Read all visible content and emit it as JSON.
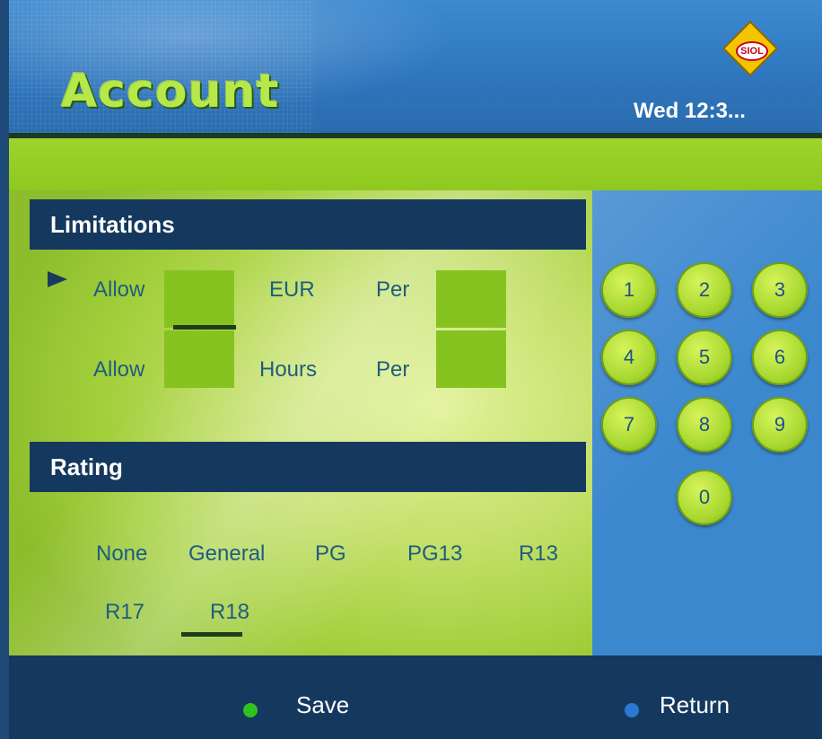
{
  "header": {
    "title": "Account",
    "logo_text": "SIOL",
    "clock": "Wed 12:3..."
  },
  "limitations": {
    "title": "Limitations",
    "rows": [
      {
        "allow_label": "Allow",
        "unit_label": "EUR",
        "per_label": "Per"
      },
      {
        "allow_label": "Allow",
        "unit_label": "Hours",
        "per_label": "Per"
      }
    ]
  },
  "rating": {
    "title": "Rating",
    "options": [
      "None",
      "General",
      "PG",
      "PG13",
      "R13",
      "R17",
      "R18"
    ],
    "selected": "R18"
  },
  "numpad": {
    "keys": [
      "1",
      "2",
      "3",
      "4",
      "5",
      "6",
      "7",
      "8",
      "9",
      "0"
    ]
  },
  "footer": {
    "save_label": "Save",
    "save_color": "#2ec21f",
    "return_label": "Return",
    "return_color": "#2b78d0"
  },
  "colors": {
    "accent_green": "#9ed42c",
    "navy": "#15385e",
    "label_blue": "#1e5d80"
  }
}
